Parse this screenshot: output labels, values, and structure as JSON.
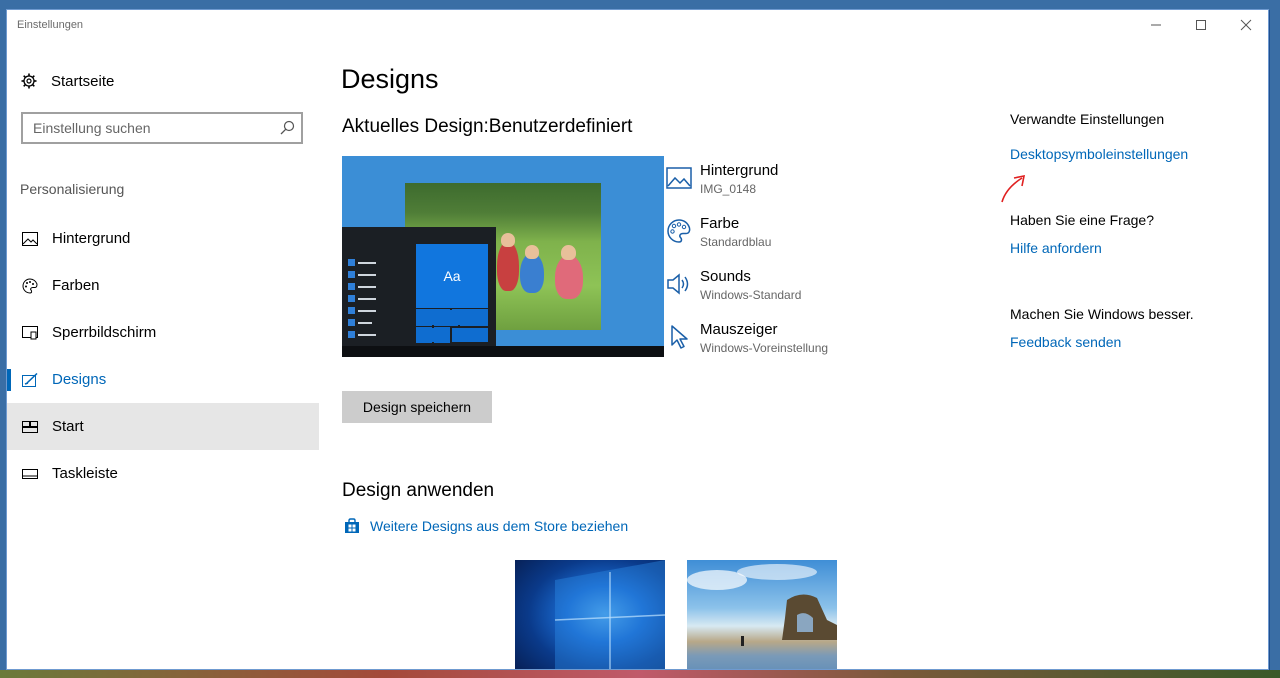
{
  "window": {
    "title": "Einstellungen",
    "minimize_symbol": "—",
    "maximize_symbol": "☐",
    "close_symbol": "✕"
  },
  "sidebar": {
    "home_label": "Startseite",
    "search_placeholder": "Einstellung suchen",
    "section_label": "Personalisierung",
    "items": [
      {
        "label": "Hintergrund",
        "icon": "picture-icon"
      },
      {
        "label": "Farben",
        "icon": "palette-icon"
      },
      {
        "label": "Sperrbildschirm",
        "icon": "lockscreen-icon"
      },
      {
        "label": "Designs",
        "icon": "designs-icon",
        "active": true
      },
      {
        "label": "Start",
        "icon": "start-icon",
        "hover": true
      },
      {
        "label": "Taskleiste",
        "icon": "taskbar-icon"
      }
    ]
  },
  "main": {
    "title": "Designs",
    "current_design_heading": "Aktuelles Design:Benutzerdefiniert",
    "preview_tile_label": "Aa",
    "attributes": [
      {
        "name": "Hintergrund",
        "value": "IMG_0148",
        "icon": "picture-icon"
      },
      {
        "name": "Farbe",
        "value": "Standardblau",
        "icon": "palette-icon"
      },
      {
        "name": "Sounds",
        "value": "Windows-Standard",
        "icon": "speaker-icon"
      },
      {
        "name": "Mauszeiger",
        "value": "Windows-Voreinstellung",
        "icon": "cursor-icon"
      }
    ],
    "save_button": "Design speichern",
    "apply_heading": "Design anwenden",
    "store_link": "Weitere Designs aus dem Store beziehen"
  },
  "related": {
    "heading": "Verwandte Einstellungen",
    "desktop_icons_link": "Desktopsymboleinstellungen",
    "question_heading": "Haben Sie eine Frage?",
    "help_link": "Hilfe anfordern",
    "better_heading": "Machen Sie Windows besser.",
    "feedback_link": "Feedback senden"
  },
  "colors": {
    "accent": "#0067b8",
    "annotation_arrow": "#e02020"
  }
}
